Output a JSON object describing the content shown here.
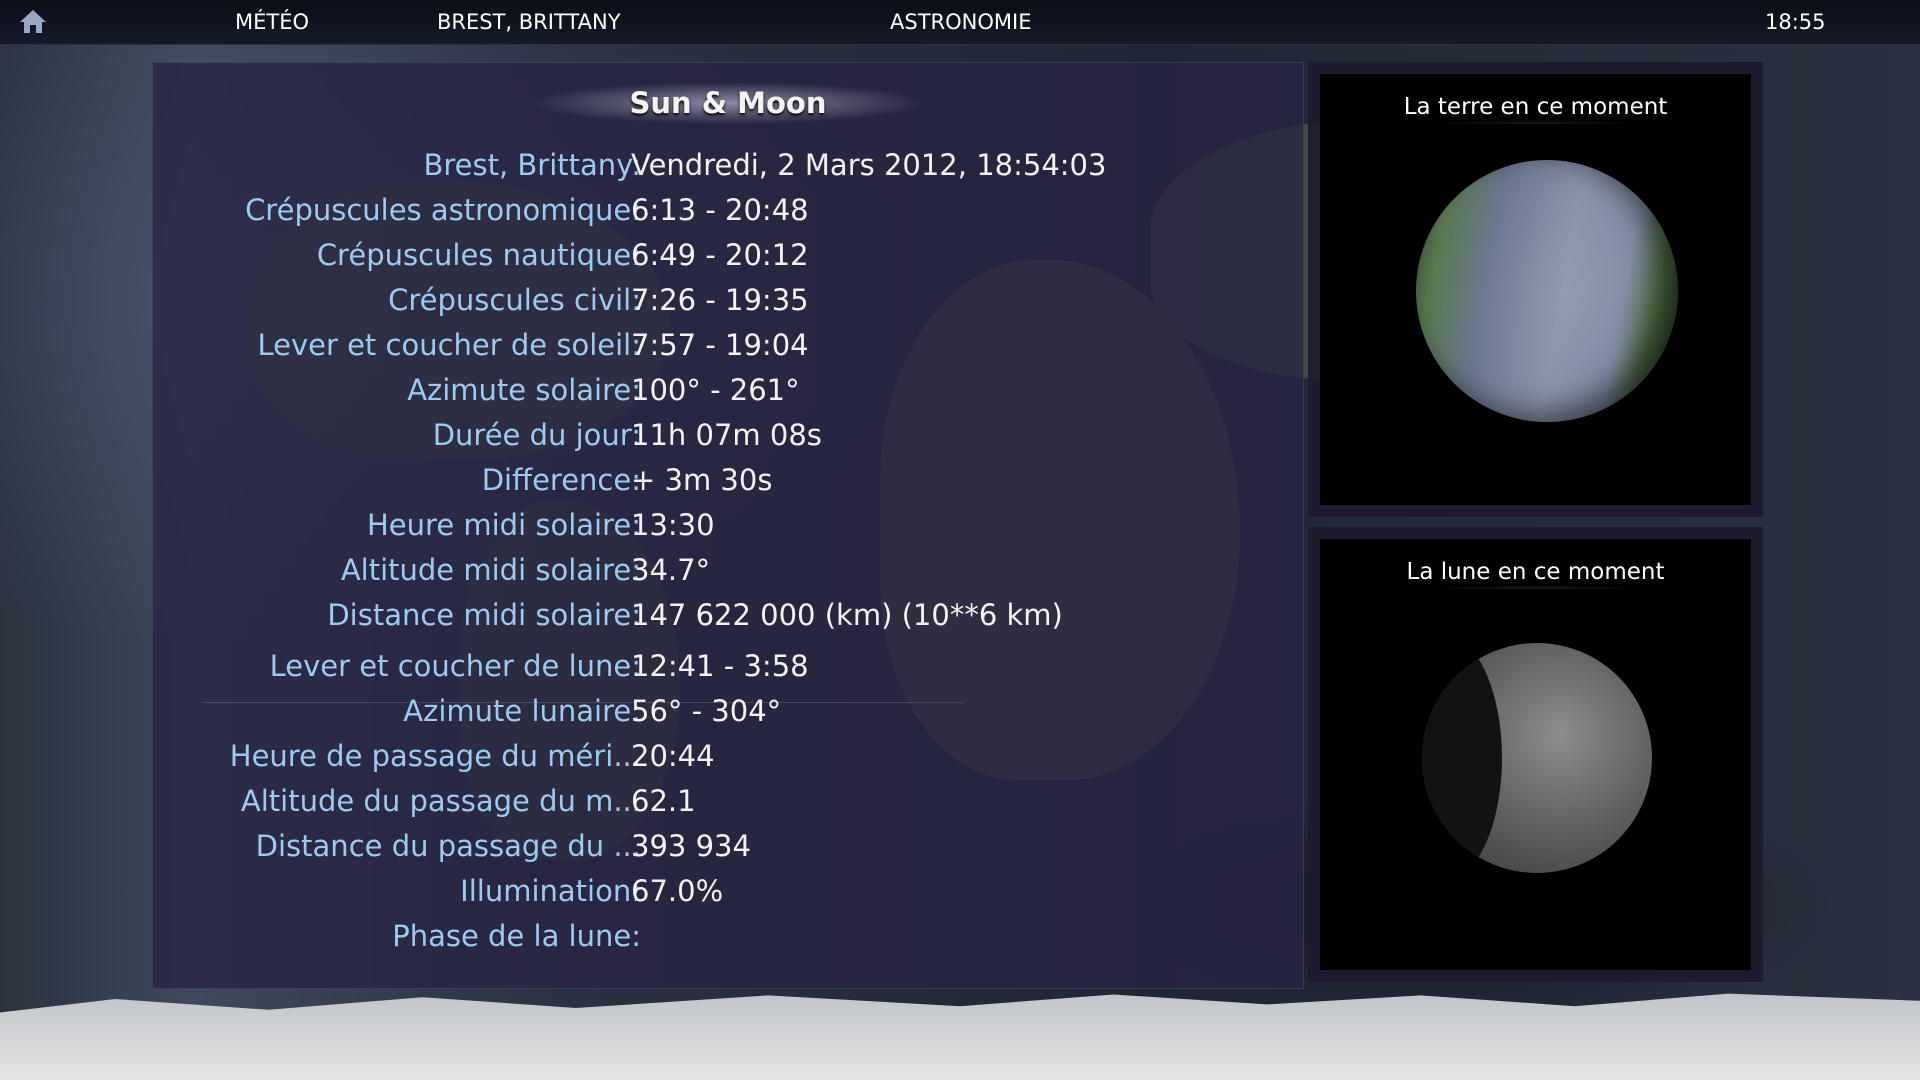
{
  "topbar": {
    "meteo": "MÉTÉO",
    "location": "BREST, BRITTANY",
    "section": "ASTRONOMIE",
    "time": "18:55"
  },
  "panel": {
    "title": "Sun & Moon",
    "sun_rows": [
      {
        "label": "Brest, Brittany:",
        "value": "Vendredi, 2 Mars 2012, 18:54:03"
      },
      {
        "label": "Crépuscules astronomique:",
        "value": "6:13 - 20:48"
      },
      {
        "label": "Crépuscules nautique:",
        "value": "6:49 - 20:12"
      },
      {
        "label": "Crépuscules civil:",
        "value": "7:26 - 19:35"
      },
      {
        "label": "Lever et coucher de soleil:",
        "value": "7:57 - 19:04"
      },
      {
        "label": "Azimute solaire:",
        "value": "100° - 261°"
      },
      {
        "label": "Durée du jour:",
        "value": "11h 07m 08s"
      },
      {
        "label": "Difference:",
        "value": "+ 3m 30s"
      },
      {
        "label": "Heure midi solaire:",
        "value": "13:30"
      },
      {
        "label": "Altitude midi solaire:",
        "value": "34.7°"
      },
      {
        "label": "Distance midi solaire:",
        "value": "147 622 000 (km) (10**6 km)"
      }
    ],
    "moon_rows": [
      {
        "label": "Lever et coucher de lune:",
        "value": "12:41 - 3:58"
      },
      {
        "label": "Azimute lunaire:",
        "value": "56° - 304°"
      },
      {
        "label": "Heure de passage du méri...",
        "value": "20:44"
      },
      {
        "label": "Altitude du passage du m...",
        "value": "62.1"
      },
      {
        "label": "Distance du passage du ...",
        "value": "393 934"
      },
      {
        "label": "Illumination:",
        "value": "67.0%"
      },
      {
        "label": "Phase de la lune:",
        "value": ""
      }
    ]
  },
  "earth_panel": {
    "title": "La terre en ce moment"
  },
  "moon_panel": {
    "title": "La lune en ce moment",
    "illumination_fraction": 0.67
  },
  "colors": {
    "label": "#9ccaf0",
    "value": "#f3f3f3",
    "panel": "#28243f"
  }
}
